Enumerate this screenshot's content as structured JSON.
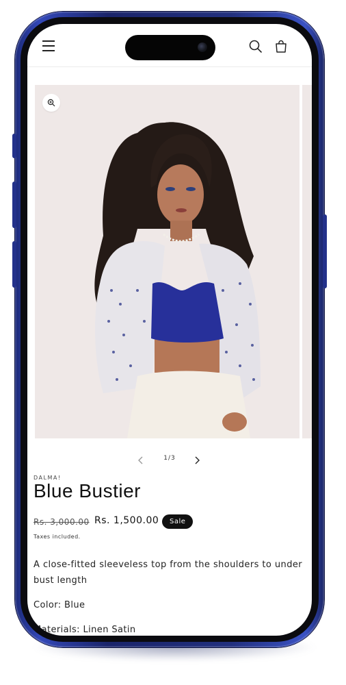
{
  "product": {
    "vendor": "DALMA!",
    "title": "Blue Bustier",
    "regular_price": "Rs. 3,000.00",
    "sale_price": "Rs. 1,500.00",
    "sale_badge": "Sale",
    "taxes_note": "Taxes included.",
    "description": "A close-fitted sleeveless top from the shoulders to under bust length",
    "color_line": "Color: Blue",
    "materials_line": "Materials: Linen Satin"
  },
  "gallery": {
    "counter": "1/3"
  },
  "icons": {
    "menu": "hamburger-menu-icon",
    "search": "search-icon",
    "cart": "shopping-bag-icon",
    "zoom": "zoom-in-icon",
    "prev": "chevron-left-icon",
    "next": "chevron-right-icon"
  },
  "colors": {
    "phone_frame": "#2a3a9e",
    "badge_bg": "#111111",
    "image_bg": "#efe8e7",
    "top_blue": "#27309a"
  }
}
